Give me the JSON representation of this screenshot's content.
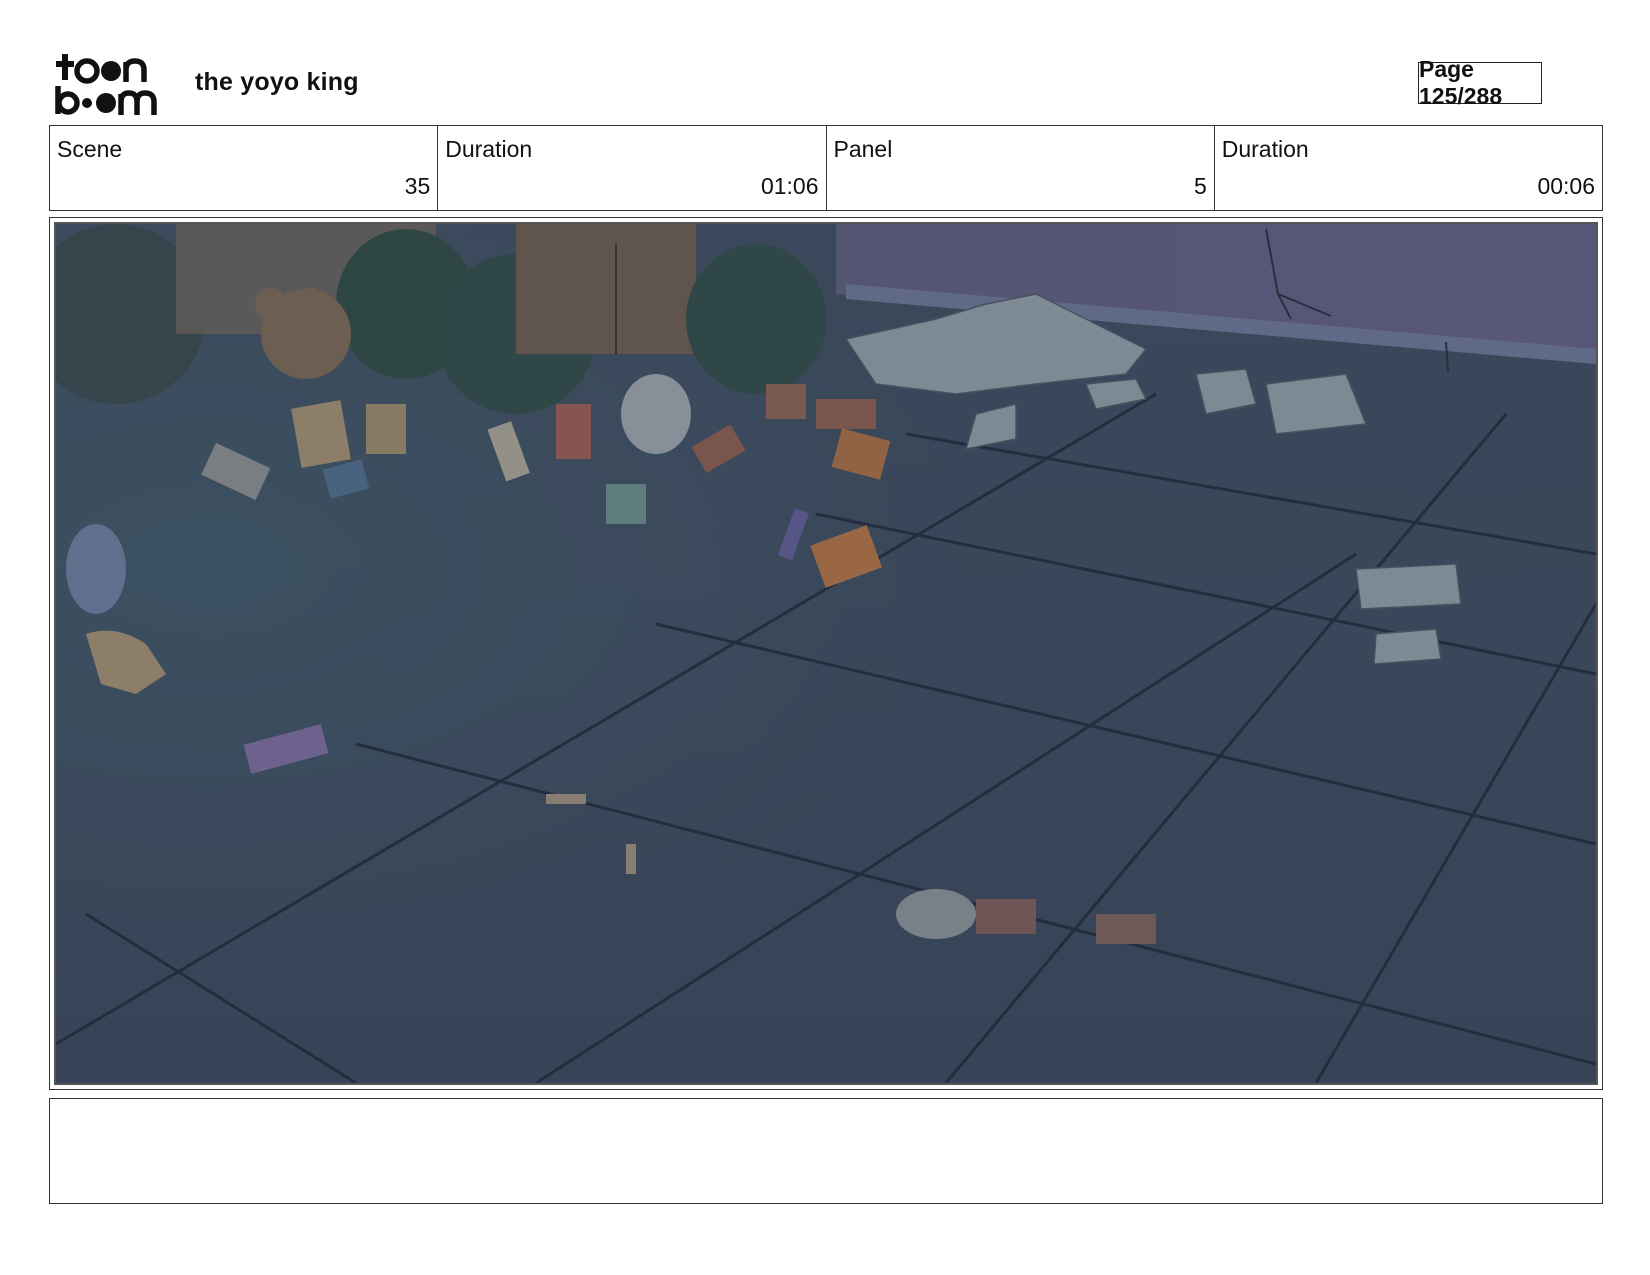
{
  "header": {
    "logo_text": "toonboom",
    "project_title": "the yoyo king",
    "page_label": "Page 125/288"
  },
  "meta": [
    {
      "label": "Scene",
      "value": "35"
    },
    {
      "label": "Duration",
      "value": "01:06"
    },
    {
      "label": "Panel",
      "value": "5"
    },
    {
      "label": "Duration",
      "value": "00:06"
    }
  ],
  "panel": {
    "description": "storyboard-frame-alley-trash"
  },
  "notes": {
    "text": ""
  }
}
